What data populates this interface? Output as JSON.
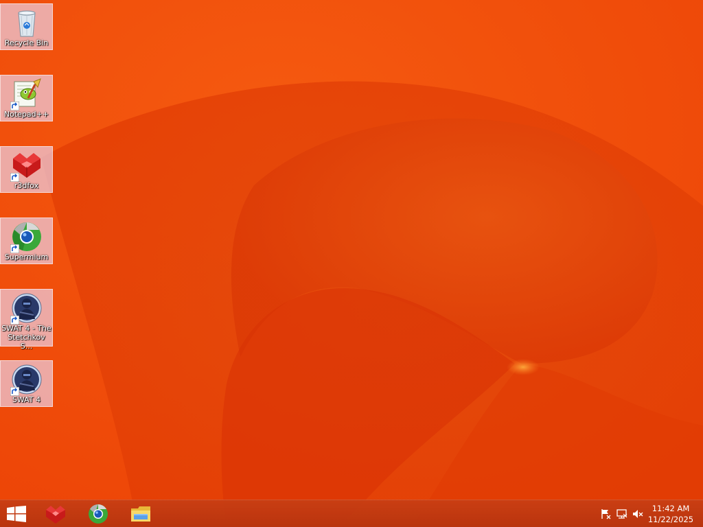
{
  "desktop": {
    "icons": [
      {
        "label": "Recycle Bin",
        "icon": "recycle-bin-icon",
        "shortcut": false
      },
      {
        "label": "Notepad++",
        "icon": "notepad-plus-plus-icon",
        "shortcut": true
      },
      {
        "label": "r3dfox",
        "icon": "r3dfox-icon",
        "shortcut": true
      },
      {
        "label": "Supermium",
        "icon": "supermium-icon",
        "shortcut": true
      },
      {
        "label": "SWAT 4 - The Stetchkov S...",
        "icon": "swat4-stetchkov-icon",
        "shortcut": true
      },
      {
        "label": "SWAT 4",
        "icon": "swat4-icon",
        "shortcut": true
      }
    ]
  },
  "taskbar": {
    "start": "windows-logo-icon",
    "pinned": [
      {
        "icon": "r3dfox-icon"
      },
      {
        "icon": "supermium-icon"
      },
      {
        "icon": "file-explorer-icon"
      }
    ],
    "tray": [
      {
        "icon": "action-center-flag-icon"
      },
      {
        "icon": "network-icon"
      },
      {
        "icon": "volume-muted-icon"
      }
    ],
    "time": "11:42 AM",
    "date": "11/22/2025"
  },
  "colors": {
    "wallpaper_base": "#f04808",
    "wallpaper_swirl": "#e03a05",
    "taskbar": "#c03a10",
    "icon_selection": "#ecd0e0"
  }
}
